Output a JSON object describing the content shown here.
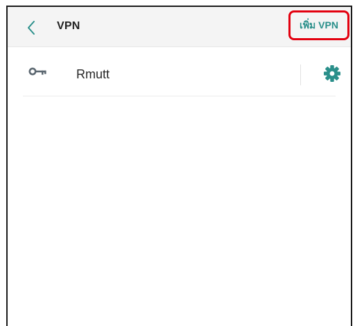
{
  "header": {
    "title": "VPN",
    "add_vpn_label": "เพิ่ม VPN",
    "back_icon": "chevron-left-icon"
  },
  "vpn_list": [
    {
      "name": "Rmutt",
      "icon": "key-icon",
      "settings_icon": "gear-icon"
    }
  ],
  "colors": {
    "accent": "#2a8f8a",
    "highlight_box": "#e3000f",
    "header_bg": "#f4f4f4",
    "icon_gray": "#5b6770"
  }
}
